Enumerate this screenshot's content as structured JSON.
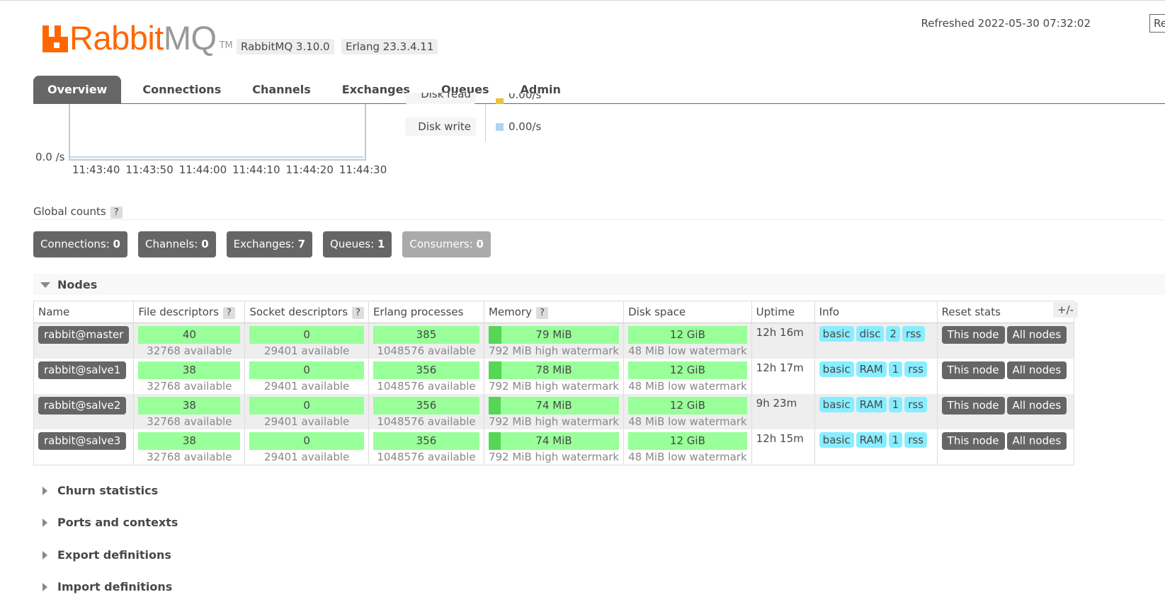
{
  "header": {
    "logo_rabbit": "Rabbit",
    "logo_mq": "MQ",
    "logo_tm": "TM",
    "version_rabbitmq": "RabbitMQ 3.10.0",
    "version_erlang": "Erlang 23.3.4.11",
    "refreshed": "Refreshed 2022-05-30 07:32:02",
    "refresh_select_value": "Re"
  },
  "tabs": [
    "Overview",
    "Connections",
    "Channels",
    "Exchanges",
    "Queues",
    "Admin"
  ],
  "chart_data": {
    "type": "line",
    "title": "",
    "ylabel_tick": "0.0 /s",
    "x_ticks": [
      "11:43:40",
      "11:43:50",
      "11:44:00",
      "11:44:10",
      "11:44:20",
      "11:44:30"
    ],
    "series": [
      {
        "name": "Disk read",
        "value": "0.00/s",
        "color": "#e8c33a"
      },
      {
        "name": "Disk write",
        "value": "0.00/s",
        "color": "#aed4f2"
      }
    ]
  },
  "global_counts": {
    "title": "Global counts",
    "help": "?",
    "items": [
      {
        "label": "Connections:",
        "value": "0"
      },
      {
        "label": "Channels:",
        "value": "0"
      },
      {
        "label": "Exchanges:",
        "value": "7"
      },
      {
        "label": "Queues:",
        "value": "1"
      },
      {
        "label": "Consumers:",
        "value": "0"
      }
    ]
  },
  "nodes": {
    "title": "Nodes",
    "columns": [
      "Name",
      "File descriptors",
      "Socket descriptors",
      "Erlang processes",
      "Memory",
      "Disk space",
      "Uptime",
      "Info",
      "Reset stats"
    ],
    "help": "?",
    "plus_minus": "+/-",
    "rows": [
      {
        "name": "rabbit@master",
        "fd": "40",
        "fd_avail": "32768 available",
        "sd": "0",
        "sd_avail": "29401 available",
        "ep": "385",
        "ep_avail": "1048576 available",
        "mem": "79 MiB",
        "mem_fill": 0.1,
        "mem_wm": "792 MiB high watermark",
        "disk": "12 GiB",
        "disk_wm": "48 MiB low watermark",
        "uptime": "12h 16m",
        "info": [
          "basic",
          "disc",
          "2",
          "rss"
        ],
        "btn_this": "This node",
        "btn_all": "All nodes"
      },
      {
        "name": "rabbit@salve1",
        "fd": "38",
        "fd_avail": "32768 available",
        "sd": "0",
        "sd_avail": "29401 available",
        "ep": "356",
        "ep_avail": "1048576 available",
        "mem": "78 MiB",
        "mem_fill": 0.1,
        "mem_wm": "792 MiB high watermark",
        "disk": "12 GiB",
        "disk_wm": "48 MiB low watermark",
        "uptime": "12h 17m",
        "info": [
          "basic",
          "RAM",
          "1",
          "rss"
        ],
        "btn_this": "This node",
        "btn_all": "All nodes"
      },
      {
        "name": "rabbit@salve2",
        "fd": "38",
        "fd_avail": "32768 available",
        "sd": "0",
        "sd_avail": "29401 available",
        "ep": "356",
        "ep_avail": "1048576 available",
        "mem": "74 MiB",
        "mem_fill": 0.09,
        "mem_wm": "792 MiB high watermark",
        "disk": "12 GiB",
        "disk_wm": "48 MiB low watermark",
        "uptime": "9h 23m",
        "info": [
          "basic",
          "RAM",
          "1",
          "rss"
        ],
        "btn_this": "This node",
        "btn_all": "All nodes"
      },
      {
        "name": "rabbit@salve3",
        "fd": "38",
        "fd_avail": "32768 available",
        "sd": "0",
        "sd_avail": "29401 available",
        "ep": "356",
        "ep_avail": "1048576 available",
        "mem": "74 MiB",
        "mem_fill": 0.09,
        "mem_wm": "792 MiB high watermark",
        "disk": "12 GiB",
        "disk_wm": "48 MiB low watermark",
        "uptime": "12h 15m",
        "info": [
          "basic",
          "RAM",
          "1",
          "rss"
        ],
        "btn_this": "This node",
        "btn_all": "All nodes"
      }
    ]
  },
  "sections": [
    "Churn statistics",
    "Ports and contexts",
    "Export definitions",
    "Import definitions"
  ]
}
